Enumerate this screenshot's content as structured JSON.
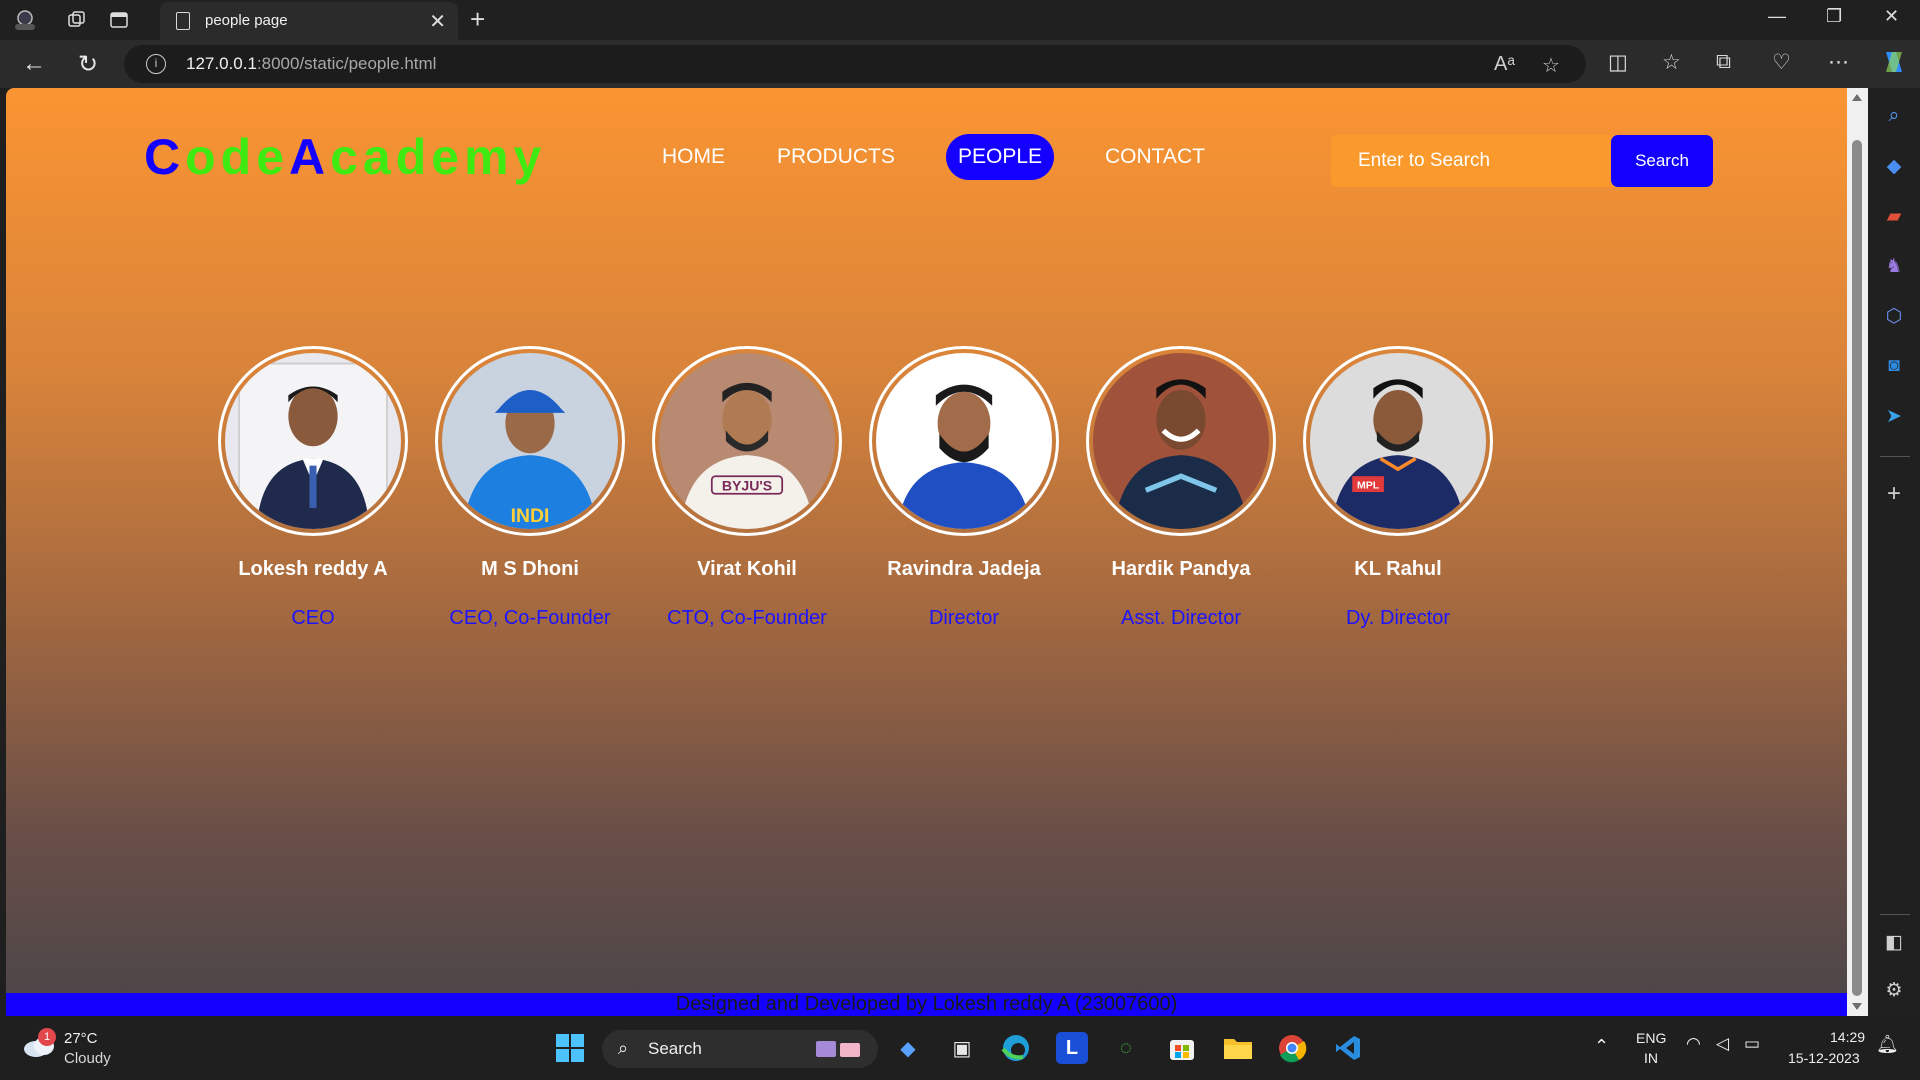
{
  "browser": {
    "tab_title": "people page",
    "url_host": "127.0.0.1",
    "url_rest": ":8000/static/people.html"
  },
  "site": {
    "logo_part1_initial": "C",
    "logo_part1_rest": "ode",
    "logo_part2_initial": "A",
    "logo_part2_rest": "cademy",
    "nav": [
      "HOME",
      "PRODUCTS",
      "PEOPLE",
      "CONTACT"
    ],
    "active_nav": "PEOPLE",
    "search_placeholder": "Enter to Search",
    "search_button": "Search",
    "footer": "Designed and Developed by Lokesh reddy A (23007600)",
    "colors": {
      "brand_blue": "#1400ff",
      "brand_green": "#3eea12",
      "orange": "#fa9432"
    }
  },
  "people": [
    {
      "name": "Lokesh reddy A",
      "role": "CEO"
    },
    {
      "name": "M S Dhoni",
      "role": "CEO, Co-Founder"
    },
    {
      "name": "Virat Kohil",
      "role": "CTO, Co-Founder"
    },
    {
      "name": "Ravindra Jadeja",
      "role": "Director"
    },
    {
      "name": "Hardik Pandya",
      "role": "Asst. Director"
    },
    {
      "name": "KL Rahul",
      "role": "Dy. Director"
    }
  ],
  "taskbar": {
    "weather_temp": "27°C",
    "weather_desc": "Cloudy",
    "weather_badge": "1",
    "search_label": "Search",
    "lang_1": "ENG",
    "lang_2": "IN",
    "time": "14:29",
    "date": "15-12-2023"
  }
}
